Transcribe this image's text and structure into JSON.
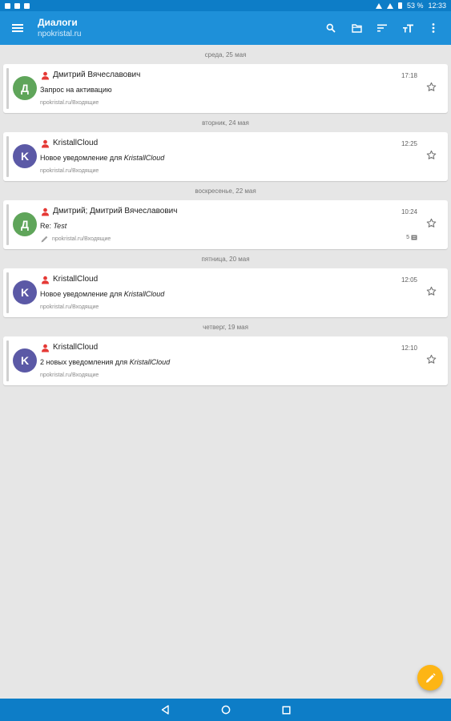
{
  "status_bar": {
    "battery": "53 %",
    "time": "12:33"
  },
  "app_bar": {
    "title": "Диалоги",
    "subtitle": "npokristal.ru",
    "icons": [
      "menu-icon",
      "search-icon",
      "folder-icon",
      "sort-icon",
      "text-size-icon",
      "more-vert-icon"
    ]
  },
  "colors": {
    "app_bar": "#1e90d9",
    "status_bar": "#0d7dc7",
    "avatar_green": "#5fa55a",
    "avatar_purple": "#5b59a6",
    "person_icon": "#e53935",
    "fab": "#fdb515"
  },
  "threads": [
    {
      "date": "среда, 25 мая",
      "sender": "Дмитрий Вячеславович",
      "time": "17:18",
      "subject_plain": "Запрос на активацию",
      "subject_italic": "",
      "folder": "npokristal.ru/Входящие",
      "avatar_letter": "Д",
      "avatar_color": "#5fa55a",
      "count": "",
      "pencil": false
    },
    {
      "date": "вторник, 24 мая",
      "sender": "KristallCloud",
      "time": "12:25",
      "subject_plain": "Новое уведомление для ",
      "subject_italic": "KristallCloud",
      "folder": "npokristal.ru/Входящие",
      "avatar_letter": "K",
      "avatar_color": "#5b59a6",
      "count": "",
      "pencil": false
    },
    {
      "date": "воскресенье, 22 мая",
      "sender": "Дмитрий; Дмитрий Вячеславович",
      "time": "10:24",
      "subject_plain": "Re: ",
      "subject_italic": "Test",
      "folder": "npokristal.ru/Входящие",
      "avatar_letter": "Д",
      "avatar_color": "#5fa55a",
      "count": "5",
      "pencil": true
    },
    {
      "date": "пятница, 20 мая",
      "sender": "KristallCloud",
      "time": "12:05",
      "subject_plain": "Новое уведомление для ",
      "subject_italic": "KristallCloud",
      "folder": "npokristal.ru/Входящие",
      "avatar_letter": "K",
      "avatar_color": "#5b59a6",
      "count": "",
      "pencil": false
    },
    {
      "date": "четверг, 19 мая",
      "sender": "KristallCloud",
      "time": "12:10",
      "subject_plain": "2 новых уведомления для ",
      "subject_italic": "KristallCloud",
      "folder": "npokristal.ru/Входящие",
      "avatar_letter": "K",
      "avatar_color": "#5b59a6",
      "count": "",
      "pencil": false
    }
  ],
  "fab": {
    "icon": "pencil-icon"
  },
  "nav_bar": {
    "icons": [
      "back-icon",
      "home-icon",
      "recents-icon"
    ]
  }
}
